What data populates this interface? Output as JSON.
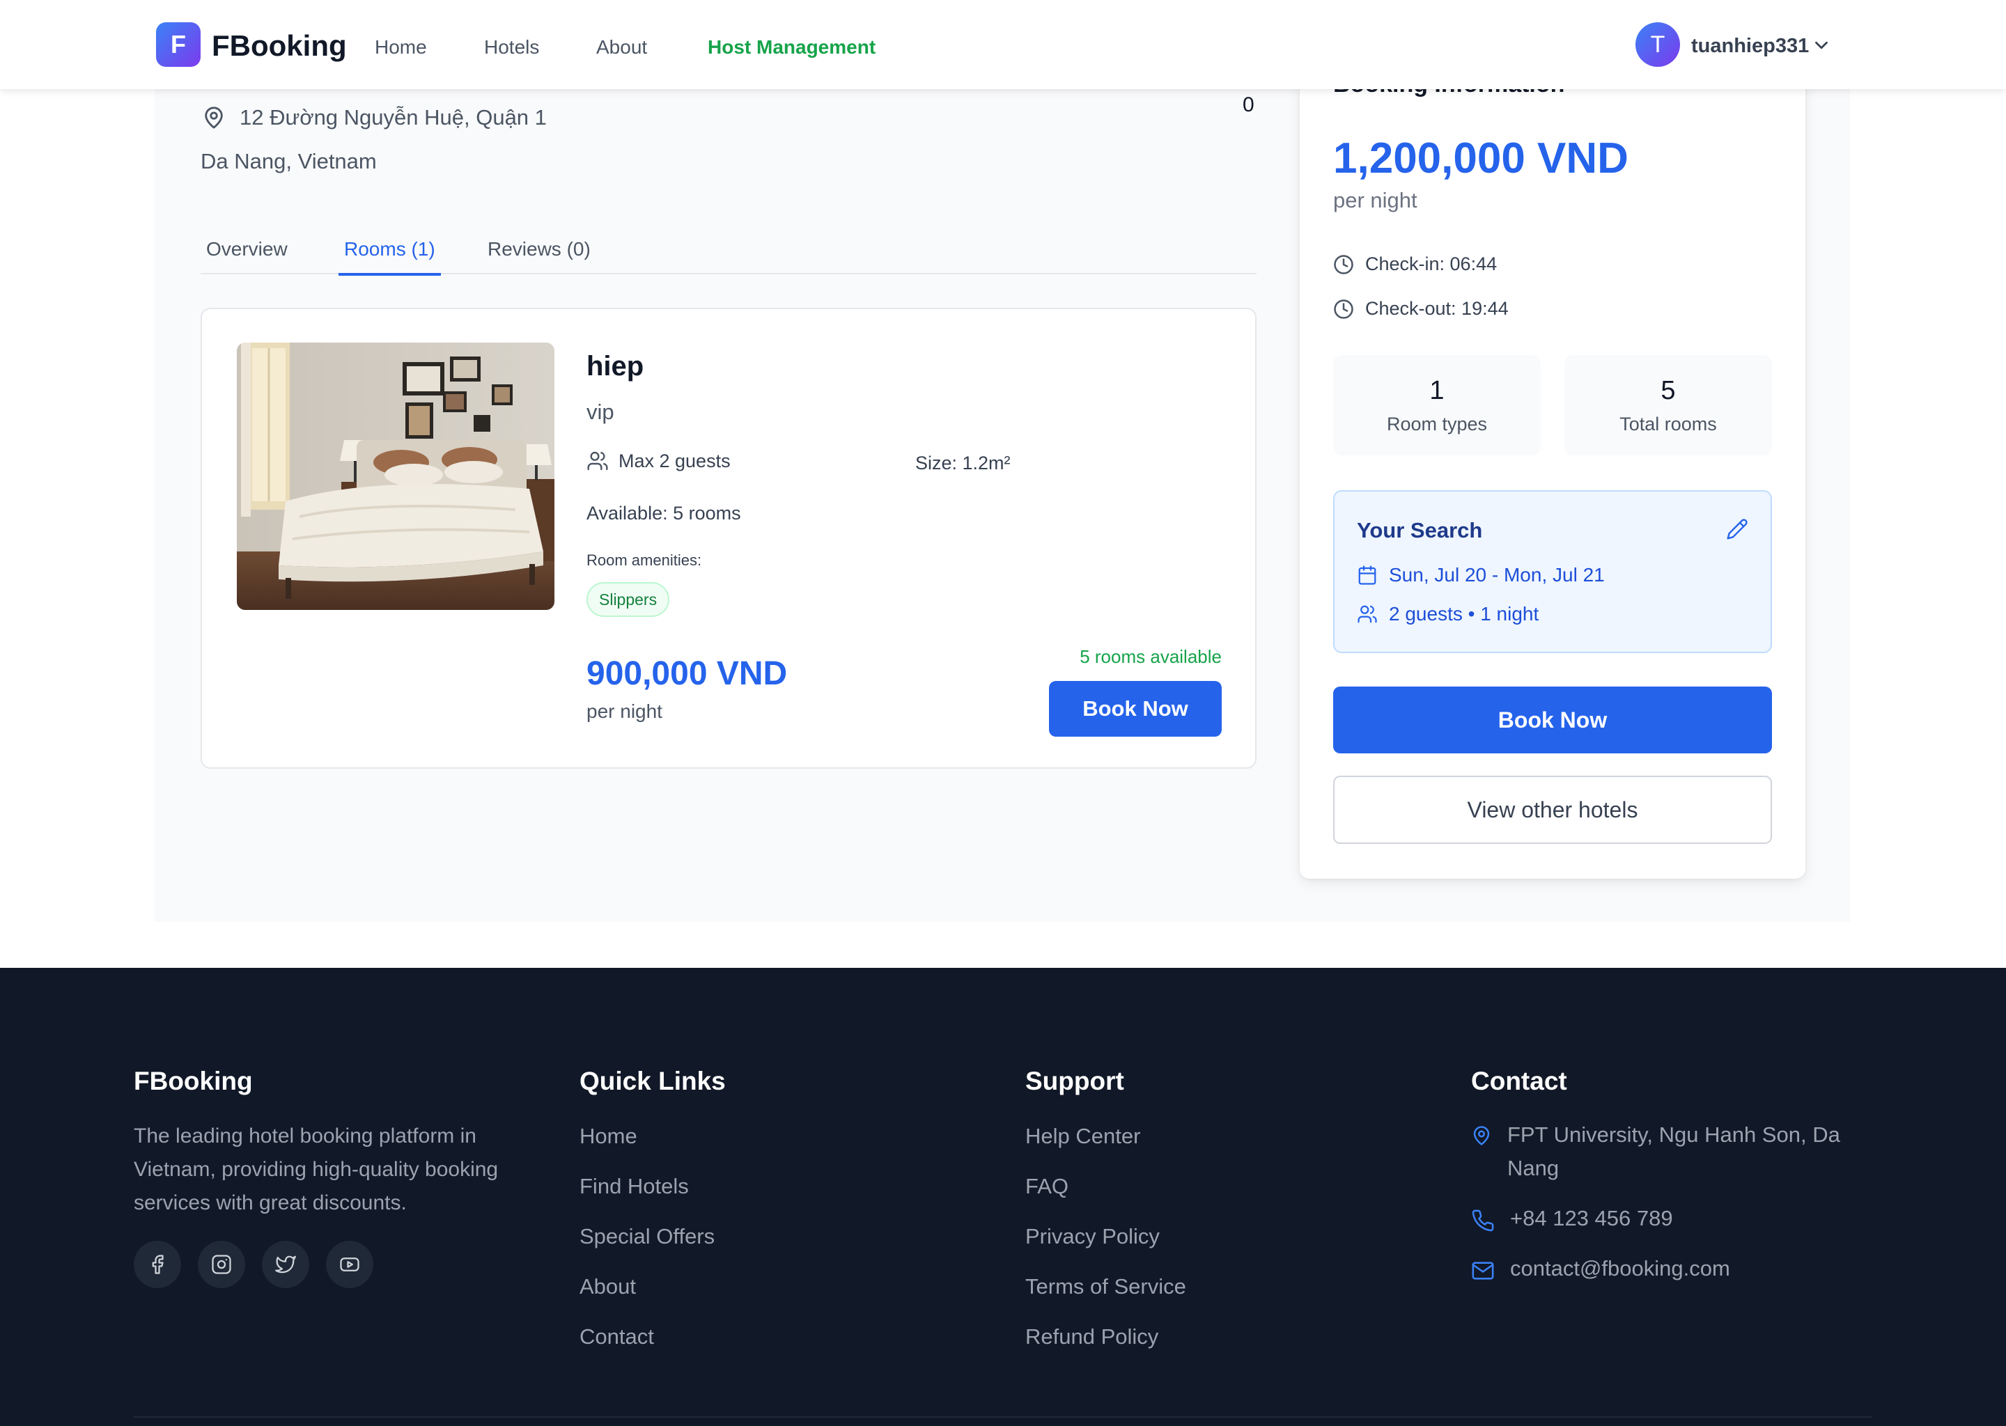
{
  "header": {
    "logo_letter": "F",
    "brand": "FBooking",
    "nav": [
      {
        "label": "Home"
      },
      {
        "label": "Hotels"
      },
      {
        "label": "About"
      },
      {
        "label": "Host Management"
      }
    ],
    "user": {
      "initial": "T",
      "name": "tuanhiep331"
    }
  },
  "hotel": {
    "address": "12 Đường Nguyễn Huệ, Quận 1",
    "city": "Da Nang, Vietnam",
    "rating_count": "0"
  },
  "tabs": [
    {
      "label": "Overview",
      "active": false
    },
    {
      "label": "Rooms (1)",
      "active": true
    },
    {
      "label": "Reviews (0)",
      "active": false
    }
  ],
  "room": {
    "name": "hiep",
    "type": "vip",
    "max_guests": "Max 2 guests",
    "size": "Size: 1.2m²",
    "available": "Available: 5 rooms",
    "amenities_label": "Room amenities:",
    "amenities": [
      "Slippers"
    ],
    "price": "900,000 VND",
    "per_night": "per night",
    "rooms_available": "5 rooms available",
    "book_label": "Book Now"
  },
  "booking": {
    "title": "Booking Information",
    "price": "1,200,000 VND",
    "per_night": "per night",
    "checkin": "Check-in: 06:44",
    "checkout": "Check-out: 19:44",
    "stats": [
      {
        "value": "1",
        "label": "Room types"
      },
      {
        "value": "5",
        "label": "Total rooms"
      }
    ],
    "search": {
      "title": "Your Search",
      "dates": "Sun, Jul 20 - Mon, Jul 21",
      "guests": "2 guests • 1 night"
    },
    "book_label": "Book Now",
    "other_label": "View other hotels"
  },
  "footer": {
    "brand": "FBooking",
    "description": "The leading hotel booking platform in Vietnam, providing high-quality booking services with great discounts.",
    "social_icons": [
      "facebook-icon",
      "instagram-icon",
      "twitter-icon",
      "youtube-icon"
    ],
    "quick_links": {
      "title": "Quick Links",
      "items": [
        "Home",
        "Find Hotels",
        "Special Offers",
        "About",
        "Contact"
      ]
    },
    "support": {
      "title": "Support",
      "items": [
        "Help Center",
        "FAQ",
        "Privacy Policy",
        "Terms of Service",
        "Refund Policy"
      ]
    },
    "contact": {
      "title": "Contact",
      "address": "FPT University, Ngu Hanh Son, Da Nang",
      "phone": "+84 123 456 789",
      "email": "contact@fbooking.com"
    }
  },
  "colors": {
    "primary": "#2563eb",
    "success": "#16a34a",
    "footer_bg": "#111827"
  }
}
